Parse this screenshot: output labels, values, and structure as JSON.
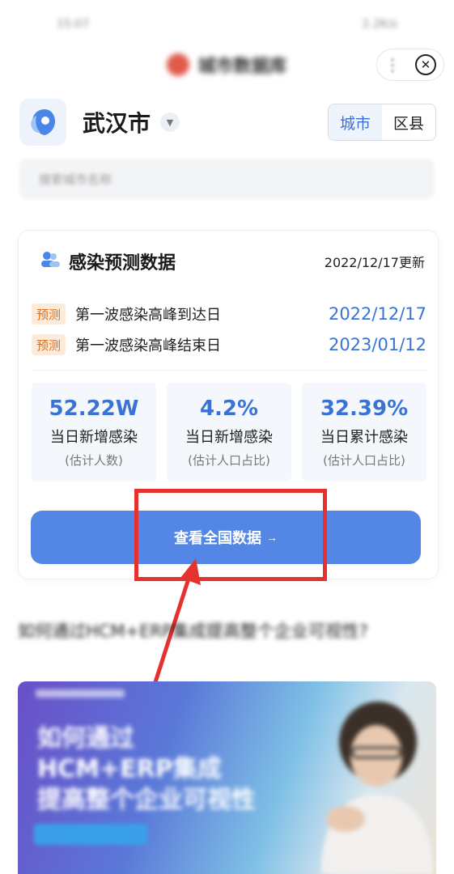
{
  "status_bar": {
    "time": "15:07",
    "right": "2.2K/s"
  },
  "header": {
    "brand": "城市数据库",
    "more": "⋮",
    "close": "✕"
  },
  "city": {
    "name": "武汉市",
    "tabs": [
      {
        "label": "城市",
        "active": true
      },
      {
        "label": "区县",
        "active": false
      }
    ]
  },
  "search": {
    "placeholder": "搜索城市名称"
  },
  "card": {
    "title": "感染预测数据",
    "updated": "2022/12/17更新",
    "forecasts": [
      {
        "tag": "预测",
        "label": "第一波感染高峰到达日",
        "date": "2022/12/17"
      },
      {
        "tag": "预测",
        "label": "第一波感染高峰结束日",
        "date": "2023/01/12"
      }
    ],
    "stats": [
      {
        "value": "52.22W",
        "label": "当日新增感染",
        "sub": "(估计人数)"
      },
      {
        "value": "4.2%",
        "label": "当日新增感染",
        "sub": "(估计人口占比)"
      },
      {
        "value": "32.39%",
        "label": "当日累计感染",
        "sub": "(估计人口占比)"
      }
    ],
    "cta": "查看全国数据",
    "cta_arrow": "→"
  },
  "ad": {
    "title": "如何通过HCM+ERP集成提高整个企业可视性?",
    "banner_lines": [
      "如何通过",
      "HCM+ERP集成",
      "提高整个企业可视性"
    ]
  },
  "colors": {
    "accent": "#3a73d6",
    "button": "#5487e5",
    "tag_bg": "#fdebd9",
    "tag_text": "#d9701f",
    "annotation": "#e5322e"
  }
}
